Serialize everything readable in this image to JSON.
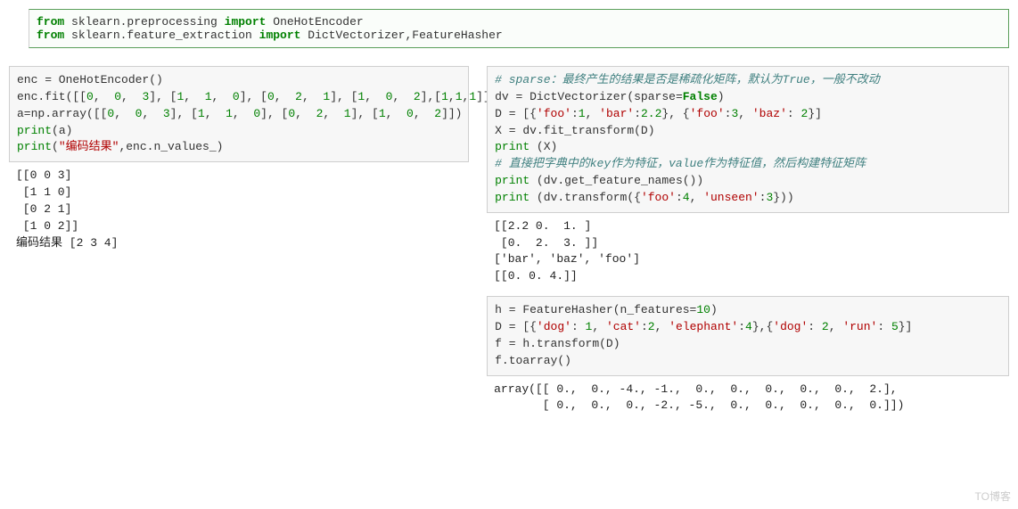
{
  "top": {
    "gutter": ":",
    "line1": {
      "kw1": "from",
      "mod1": " sklearn.preprocessing ",
      "kw2": "import",
      "rest": " OneHotEncoder"
    },
    "line2": {
      "kw1": "from",
      "mod1": " sklearn.feature_extraction ",
      "kw2": "import",
      "rest": " DictVectorizer,FeatureHasher"
    }
  },
  "left_code": {
    "l1": {
      "a": "enc = OneHotEncoder()"
    },
    "l2": {
      "a": "enc.fit([[",
      "n1": "0",
      "c1": ",  ",
      "n2": "0",
      "c2": ",  ",
      "n3": "3",
      "c3": "], [",
      "n4": "1",
      "c4": ",  ",
      "n5": "1",
      "c5": ",  ",
      "n6": "0",
      "c6": "], [",
      "n7": "0",
      "c7": ",  ",
      "n8": "2",
      "c8": ",  ",
      "n9": "1",
      "c9": "], [",
      "n10": "1",
      "c10": ",  ",
      "n11": "0",
      "c11": ",  ",
      "n12": "2",
      "c12": "],[",
      "n13": "1",
      "c13": ",",
      "n14": "1",
      "c14": ",",
      "n15": "1",
      "c15": "]])"
    },
    "l3": {
      "a": "a=np.array([[",
      "n1": "0",
      "c1": ",  ",
      "n2": "0",
      "c2": ",  ",
      "n3": "3",
      "c3": "], [",
      "n4": "1",
      "c4": ",  ",
      "n5": "1",
      "c5": ",  ",
      "n6": "0",
      "c6": "], [",
      "n7": "0",
      "c7": ",  ",
      "n8": "2",
      "c8": ",  ",
      "n9": "1",
      "c9": "], [",
      "n10": "1",
      "c10": ",  ",
      "n11": "0",
      "c11": ",  ",
      "n12": "2",
      "c12": "]])"
    },
    "l4": {
      "p": "print",
      "a": "(a)"
    },
    "l5": {
      "p": "print",
      "a": "(",
      "s": "\"编码结果\"",
      "b": ",enc.n_values_)"
    }
  },
  "left_out": "[[0 0 3]\n [1 1 0]\n [0 2 1]\n [1 0 2]]\n编码结果 [2 3 4]",
  "right_code1": {
    "c1": "# sparse：最终产生的结果是否是稀疏化矩阵，默认为True，一般不改动",
    "l2": {
      "a": "dv = DictVectorizer(sparse=",
      "kw": "False",
      "b": ")"
    },
    "l3": {
      "a": "D = [{",
      "s1": "'foo'",
      "b": ":",
      "n1": "1",
      "c1": ", ",
      "s2": "'bar'",
      "d": ":",
      "n2": "2.2",
      "c2": "}, {",
      "s3": "'foo'",
      "e": ":",
      "n3": "3",
      "c3": ", ",
      "s4": "'baz'",
      "f": ": ",
      "n4": "2",
      "g": "}]"
    },
    "l4": {
      "a": "X = dv.fit_transform(D)"
    },
    "l5": {
      "p": "print",
      "a": " (X)"
    },
    "c2": "# 直接把字典中的key作为特征，value作为特征值，然后构建特征矩阵",
    "l7": {
      "p": "print",
      "a": " (dv.get_feature_names())"
    },
    "l8": {
      "p": "print",
      "a": " (dv.transform({",
      "s1": "'foo'",
      "b": ":",
      "n1": "4",
      "c": ", ",
      "s2": "'unseen'",
      "d": ":",
      "n2": "3",
      "e": "}))"
    }
  },
  "right_out1": "[[2.2 0.  1. ]\n [0.  2.  3. ]]\n['bar', 'baz', 'foo']\n[[0. 0. 4.]]",
  "right_code2": {
    "l1": {
      "a": "h = FeatureHasher(n_features=",
      "n1": "10",
      "b": ")"
    },
    "l2": {
      "a": "D = [{",
      "s1": "'dog'",
      "b": ": ",
      "n1": "1",
      "c1": ", ",
      "s2": "'cat'",
      "d": ":",
      "n2": "2",
      "c2": ", ",
      "s3": "'elephant'",
      "e": ":",
      "n3": "4",
      "c3": "},{",
      "s4": "'dog'",
      "f": ": ",
      "n4": "2",
      "c4": ", ",
      "s5": "'run'",
      "g": ": ",
      "n5": "5",
      "h": "}]"
    },
    "l3": {
      "a": "f = h.transform(D)"
    },
    "l4": {
      "a": "f.toarray()"
    }
  },
  "right_out2": "array([[ 0.,  0., -4., -1.,  0.,  0.,  0.,  0.,  0.,  2.],\n       [ 0.,  0.,  0., -2., -5.,  0.,  0.,  0.,  0.,  0.]])",
  "watermark": "TO博客"
}
